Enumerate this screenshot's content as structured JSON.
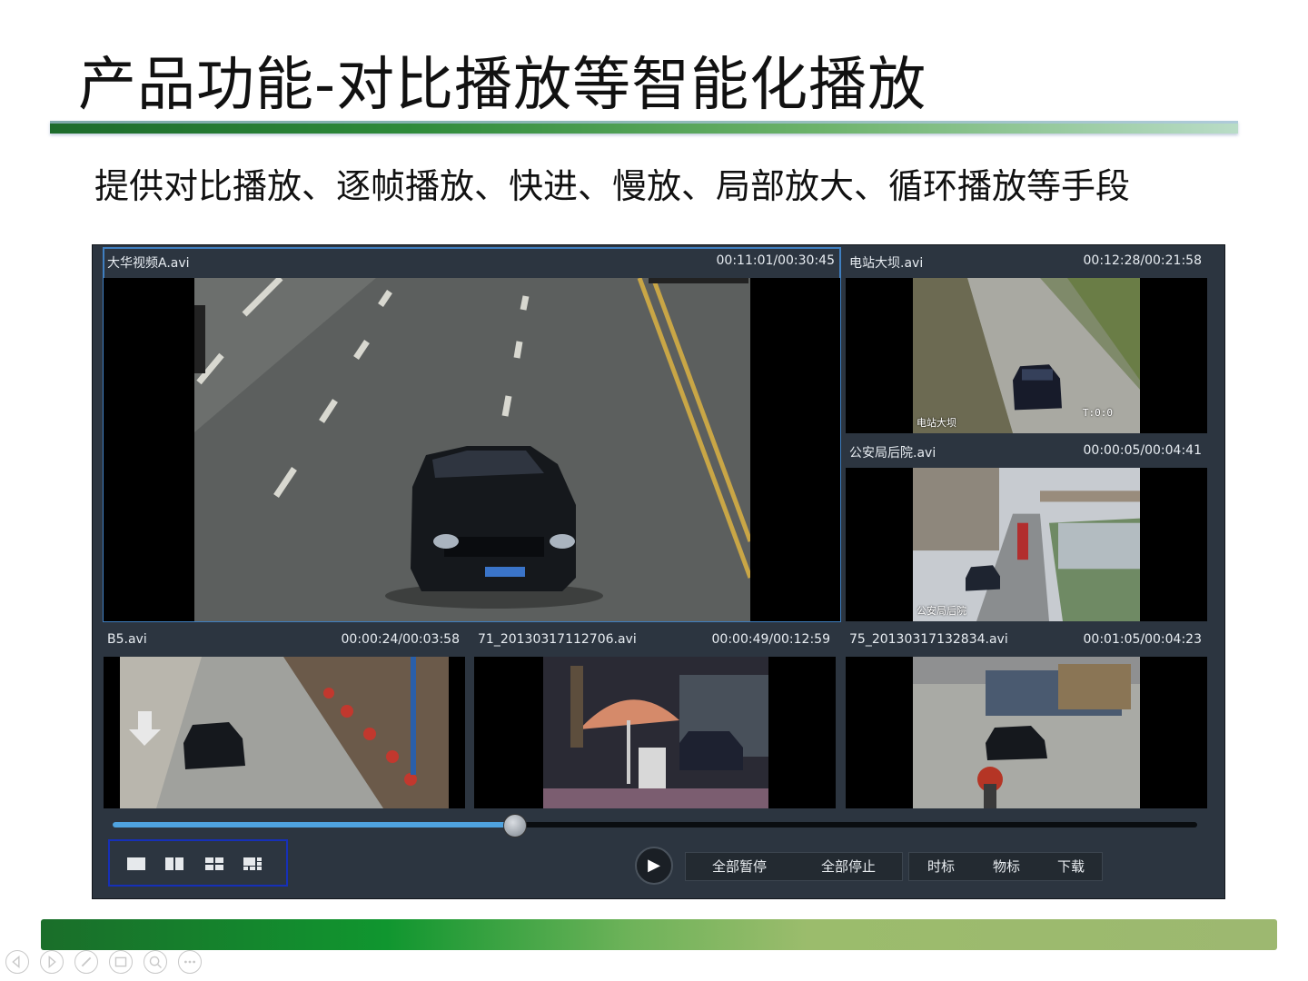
{
  "slide": {
    "title": "产品功能-对比播放等智能化播放",
    "subtitle": "提供对比播放、逐帧播放、快进、慢放、局部放大、循环播放等手段"
  },
  "panels": [
    {
      "name": "大华视频A.avi",
      "time": "00:11:01/00:30:45"
    },
    {
      "name": "电站大坝.avi",
      "time": "00:12:28/00:21:58",
      "osd": "电站大坝",
      "osd2": "T:0:0"
    },
    {
      "name": "公安局后院.avi",
      "time": "00:00:05/00:04:41",
      "osd": "公安局后院"
    },
    {
      "name": "B5.avi",
      "time": "00:00:24/00:03:58"
    },
    {
      "name": "71_20130317112706.avi",
      "time": "00:00:49/00:12:59"
    },
    {
      "name": "75_20130317132834.avi",
      "time": "00:01:05/00:04:23"
    }
  ],
  "playback": {
    "progress": 0.37
  },
  "controls": {
    "pause_all": "全部暂停",
    "stop_all": "全部停止",
    "time_mark": "时标",
    "object_mark": "物标",
    "download": "下载"
  },
  "colors": {
    "player_bg": "#2c3540",
    "active_border": "#3f7fc0",
    "progress": "#4fa3e0",
    "layout_box_border": "#1630b8"
  },
  "icons": [
    "layout-1-icon",
    "layout-2-icon",
    "layout-4-icon",
    "layout-6-icon",
    "play-icon"
  ]
}
